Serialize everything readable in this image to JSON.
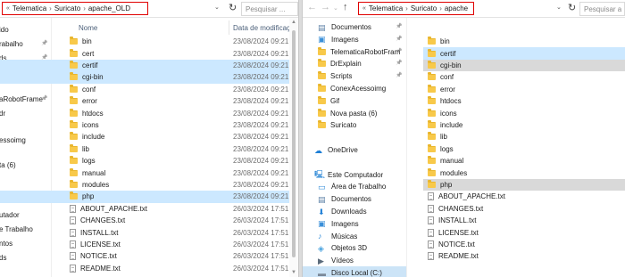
{
  "left": {
    "breadcrumb": [
      "Telematica",
      "Suricato",
      "apache_OLD"
    ],
    "search_placeholder": "Pesquisar ...",
    "col_name": "Nome",
    "col_date": "Data de modificação",
    "sidebar": [
      "ido",
      "rabalho",
      "ds",
      "ts",
      "aRobotFrame",
      "dr",
      "essoimg",
      "ta (6)",
      "utador",
      "e Trabalho",
      "ntos",
      "ds"
    ],
    "rows": [
      {
        "name": "bin",
        "date": "23/08/2024 09:21",
        "type": "folder",
        "state": ""
      },
      {
        "name": "cert",
        "date": "23/08/2024 09:21",
        "type": "folder",
        "state": ""
      },
      {
        "name": "certif",
        "date": "23/08/2024 09:21",
        "type": "folder",
        "state": "sel"
      },
      {
        "name": "cgi-bin",
        "date": "23/08/2024 09:21",
        "type": "folder",
        "state": "sel"
      },
      {
        "name": "conf",
        "date": "23/08/2024 09:21",
        "type": "folder",
        "state": ""
      },
      {
        "name": "error",
        "date": "23/08/2024 09:21",
        "type": "folder",
        "state": ""
      },
      {
        "name": "htdocs",
        "date": "23/08/2024 09:21",
        "type": "folder",
        "state": ""
      },
      {
        "name": "icons",
        "date": "23/08/2024 09:21",
        "type": "folder",
        "state": ""
      },
      {
        "name": "include",
        "date": "23/08/2024 09:21",
        "type": "folder",
        "state": ""
      },
      {
        "name": "lib",
        "date": "23/08/2024 09:21",
        "type": "folder",
        "state": ""
      },
      {
        "name": "logs",
        "date": "23/08/2024 09:21",
        "type": "folder",
        "state": ""
      },
      {
        "name": "manual",
        "date": "23/08/2024 09:21",
        "type": "folder",
        "state": ""
      },
      {
        "name": "modules",
        "date": "23/08/2024 09:21",
        "type": "folder",
        "state": ""
      },
      {
        "name": "php",
        "date": "23/08/2024 09:21",
        "type": "folder",
        "state": "sel"
      },
      {
        "name": "ABOUT_APACHE.txt",
        "date": "26/03/2024 17:51",
        "type": "txt",
        "state": ""
      },
      {
        "name": "CHANGES.txt",
        "date": "26/03/2024 17:51",
        "type": "txt",
        "state": ""
      },
      {
        "name": "INSTALL.txt",
        "date": "26/03/2024 17:51",
        "type": "txt",
        "state": ""
      },
      {
        "name": "LICENSE.txt",
        "date": "26/03/2024 17:51",
        "type": "txt",
        "state": ""
      },
      {
        "name": "NOTICE.txt",
        "date": "26/03/2024 17:51",
        "type": "txt",
        "state": ""
      },
      {
        "name": "README.txt",
        "date": "26/03/2024 17:51",
        "type": "txt",
        "state": ""
      }
    ]
  },
  "right": {
    "breadcrumb": [
      "Telematica",
      "Suricato",
      "apache"
    ],
    "search_placeholder": "Pesquisar a",
    "sidebar": [
      {
        "label": "Documentos",
        "icon": "documents-icon",
        "pin": true
      },
      {
        "label": "Imagens",
        "icon": "images-icon",
        "pin": true
      },
      {
        "label": "TelematicaRobotFrame",
        "icon": "folder-icon",
        "pin": true
      },
      {
        "label": "DrExplain",
        "icon": "folder-icon",
        "pin": true
      },
      {
        "label": "Scripts",
        "icon": "folder-icon",
        "pin": true
      },
      {
        "label": "ConexAcessoimg",
        "icon": "folder-icon",
        "pin": false
      },
      {
        "label": "Gif",
        "icon": "folder-icon",
        "pin": false
      },
      {
        "label": "Nova pasta (6)",
        "icon": "folder-icon",
        "pin": false
      },
      {
        "label": "Suricato",
        "icon": "folder-icon",
        "pin": false
      },
      {
        "label": "",
        "icon": "",
        "pin": false
      },
      {
        "label": "OneDrive",
        "icon": "onedrive-icon",
        "pin": false
      },
      {
        "label": "",
        "icon": "",
        "pin": false
      },
      {
        "label": "Este Computador",
        "icon": "computer-icon",
        "pin": false
      },
      {
        "label": "Área de Trabalho",
        "icon": "desktop-icon",
        "pin": false
      },
      {
        "label": "Documentos",
        "icon": "documents-icon",
        "pin": false
      },
      {
        "label": "Downloads",
        "icon": "downloads-icon",
        "pin": false
      },
      {
        "label": "Imagens",
        "icon": "images-icon",
        "pin": false
      },
      {
        "label": "Músicas",
        "icon": "music-icon",
        "pin": false
      },
      {
        "label": "Objetos 3D",
        "icon": "objects3d-icon",
        "pin": false
      },
      {
        "label": "Vídeos",
        "icon": "videos-icon",
        "pin": false
      },
      {
        "label": "Disco Local (C:)",
        "icon": "disk-icon",
        "pin": false
      }
    ],
    "rows": [
      {
        "name": "bin",
        "type": "folder",
        "state": ""
      },
      {
        "name": "certif",
        "type": "folder",
        "state": "sel"
      },
      {
        "name": "cgi-bin",
        "type": "folder",
        "state": "gray"
      },
      {
        "name": "conf",
        "type": "folder",
        "state": ""
      },
      {
        "name": "error",
        "type": "folder",
        "state": ""
      },
      {
        "name": "htdocs",
        "type": "folder",
        "state": ""
      },
      {
        "name": "icons",
        "type": "folder",
        "state": ""
      },
      {
        "name": "include",
        "type": "folder",
        "state": ""
      },
      {
        "name": "lib",
        "type": "folder",
        "state": ""
      },
      {
        "name": "logs",
        "type": "folder",
        "state": ""
      },
      {
        "name": "manual",
        "type": "folder",
        "state": ""
      },
      {
        "name": "modules",
        "type": "folder",
        "state": ""
      },
      {
        "name": "php",
        "type": "folder",
        "state": "gray"
      },
      {
        "name": "ABOUT_APACHE.txt",
        "type": "txt",
        "state": ""
      },
      {
        "name": "CHANGES.txt",
        "type": "txt",
        "state": ""
      },
      {
        "name": "INSTALL.txt",
        "type": "txt",
        "state": ""
      },
      {
        "name": "LICENSE.txt",
        "type": "txt",
        "state": ""
      },
      {
        "name": "NOTICE.txt",
        "type": "txt",
        "state": ""
      },
      {
        "name": "README.txt",
        "type": "txt",
        "state": ""
      }
    ]
  },
  "colors": {
    "selected": "#cce8ff",
    "gray_highlight": "#d9d9d9",
    "breadcrumb_border": "#e00000",
    "folder": "#f8c94a"
  }
}
